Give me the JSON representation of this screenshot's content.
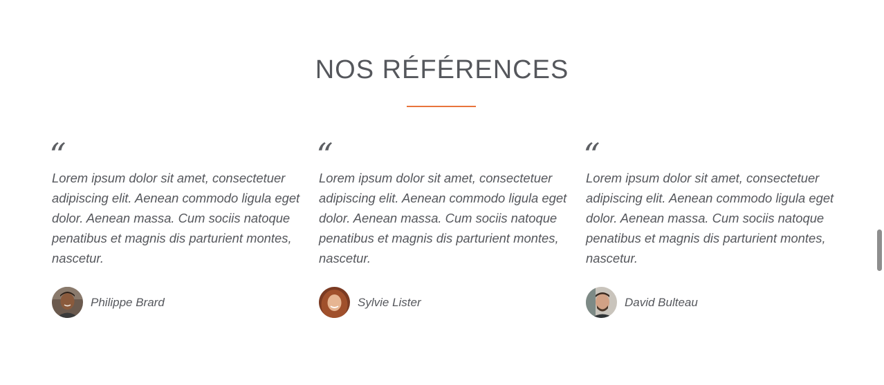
{
  "section": {
    "title": "NOS RÉFÉRENCES",
    "accent_color": "#e8743b"
  },
  "testimonials": [
    {
      "quote_icon": "quote-icon",
      "text": "Lorem ipsum dolor sit amet, consectetuer adipiscing elit. Aenean commodo ligula eget dolor. Aenean massa. Cum sociis natoque penatibus et magnis dis parturient montes, nascetur.",
      "author": "Philippe Brard"
    },
    {
      "quote_icon": "quote-icon",
      "text": "Lorem ipsum dolor sit amet, consectetuer adipiscing elit. Aenean commodo ligula eget dolor. Aenean massa. Cum sociis natoque penatibus et magnis dis parturient montes, nascetur.",
      "author": "Sylvie Lister"
    },
    {
      "quote_icon": "quote-icon",
      "text": "Lorem ipsum dolor sit amet, consectetuer adipiscing elit. Aenean commodo ligula eget dolor. Aenean massa. Cum sociis natoque penatibus et magnis dis parturient montes, nascetur.",
      "author": "David Bulteau"
    }
  ]
}
